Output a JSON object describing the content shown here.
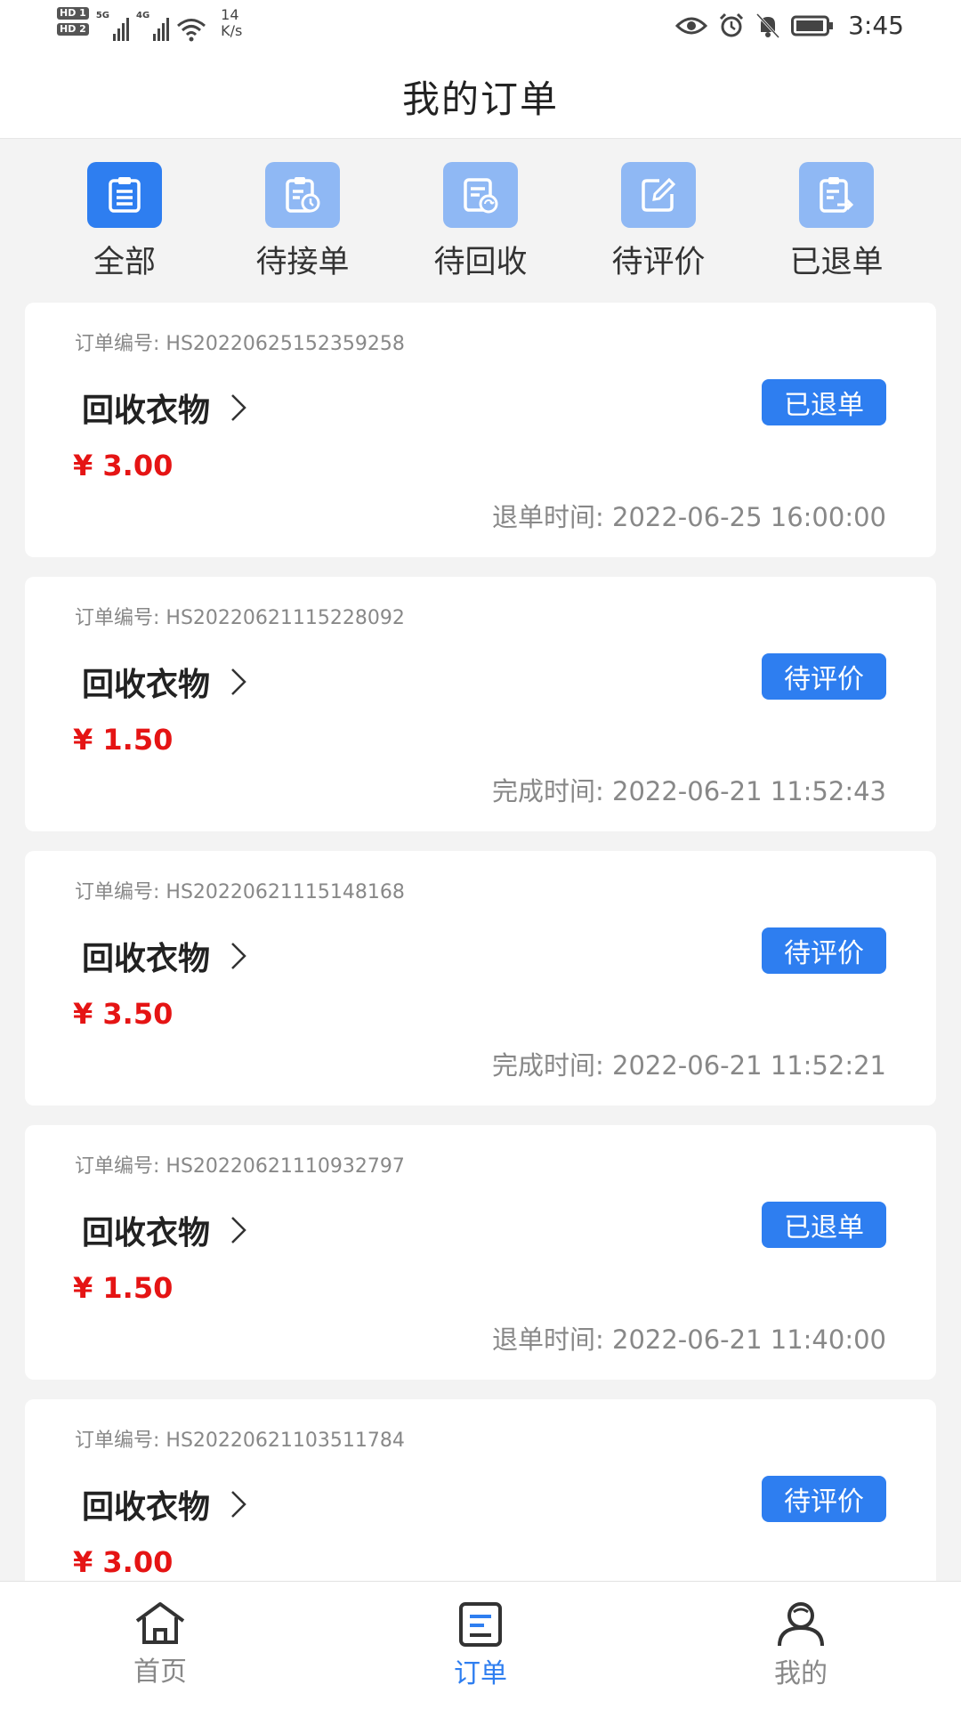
{
  "status_bar": {
    "hd1": "HD 1",
    "hd2": "HD 2",
    "sim1": "5G",
    "sim2": "4G",
    "speed_value": "14",
    "speed_unit": "K/s",
    "time": "3:45",
    "icons": [
      "eye-icon",
      "alarm-icon",
      "bell-off-icon",
      "battery-icon"
    ]
  },
  "header": {
    "title": "我的订单"
  },
  "tabs": [
    {
      "label": "全部",
      "icon": "list-icon",
      "active": true
    },
    {
      "label": "待接单",
      "icon": "clipboard-clock-icon",
      "active": false
    },
    {
      "label": "待回收",
      "icon": "recycle-doc-icon",
      "active": false
    },
    {
      "label": "待评价",
      "icon": "edit-icon",
      "active": false
    },
    {
      "label": "已退单",
      "icon": "doc-return-icon",
      "active": false
    }
  ],
  "orders": [
    {
      "order_no_label": "订单编号:",
      "order_no": "HS20220625152359258",
      "item": "回收衣物",
      "status": "已退单",
      "price": "¥ 3.00",
      "time_label": "退单时间:",
      "time": "2022-06-25 16:00:00"
    },
    {
      "order_no_label": "订单编号:",
      "order_no": "HS20220621115228092",
      "item": "回收衣物",
      "status": "待评价",
      "price": "¥ 1.50",
      "time_label": "完成时间:",
      "time": "2022-06-21 11:52:43"
    },
    {
      "order_no_label": "订单编号:",
      "order_no": "HS20220621115148168",
      "item": "回收衣物",
      "status": "待评价",
      "price": "¥ 3.50",
      "time_label": "完成时间:",
      "time": "2022-06-21 11:52:21"
    },
    {
      "order_no_label": "订单编号:",
      "order_no": "HS20220621110932797",
      "item": "回收衣物",
      "status": "已退单",
      "price": "¥ 1.50",
      "time_label": "退单时间:",
      "time": "2022-06-21 11:40:00"
    },
    {
      "order_no_label": "订单编号:",
      "order_no": "HS20220621103511784",
      "item": "回收衣物",
      "status": "待评价",
      "price": "¥ 3.00",
      "time_label": "",
      "time": ""
    }
  ],
  "bottom_nav": [
    {
      "label": "首页",
      "icon": "home-icon",
      "active": false
    },
    {
      "label": "订单",
      "icon": "order-icon",
      "active": true
    },
    {
      "label": "我的",
      "icon": "user-icon",
      "active": false
    }
  ],
  "colors": {
    "accent": "#2e7ef0",
    "accent_light": "#8fb8f4",
    "price": "#e51414",
    "background": "#f3f3f3"
  }
}
